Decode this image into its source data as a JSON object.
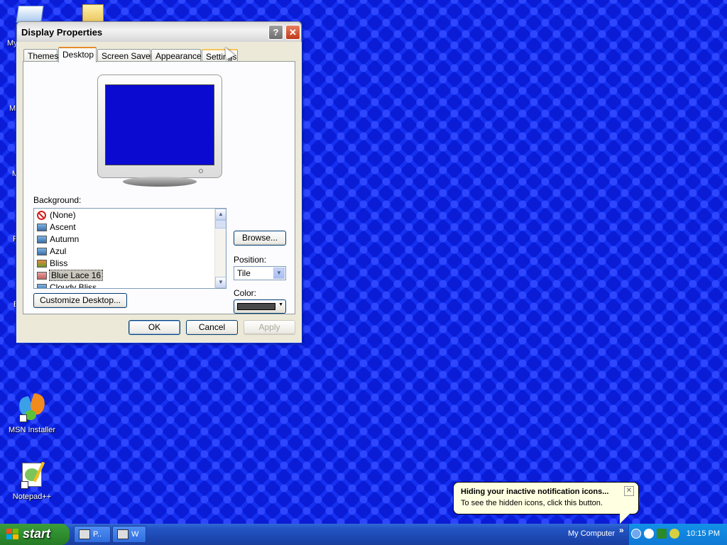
{
  "desktop": {
    "icons": [
      {
        "label": "MSN Installer",
        "icon": "msn-butterfly-icon"
      },
      {
        "label": "Notepad++",
        "icon": "notepadpp-icon"
      }
    ],
    "partial_labels": [
      "My",
      "M",
      "M",
      "R",
      "E"
    ]
  },
  "dialog": {
    "title": "Display Properties",
    "help_label": "?",
    "close_label": "✕",
    "tabs": [
      {
        "label": "Themes"
      },
      {
        "label": "Desktop"
      },
      {
        "label": "Screen Saver"
      },
      {
        "label": "Appearance"
      },
      {
        "label": "Settings"
      }
    ],
    "active_tab": "Desktop",
    "background_label": "Background:",
    "background_items": [
      {
        "label": "(None)",
        "icon": "none-icon"
      },
      {
        "label": "Ascent",
        "icon": "image-thumb-icon"
      },
      {
        "label": "Autumn",
        "icon": "image-thumb-icon"
      },
      {
        "label": "Azul",
        "icon": "image-thumb-icon"
      },
      {
        "label": "Bliss",
        "icon": "image-thumb-icon"
      },
      {
        "label": "Blue Lace 16",
        "icon": "image-thumb-icon"
      },
      {
        "label": "Cloudy Bliss",
        "icon": "image-thumb-icon"
      }
    ],
    "selected_background": "Blue Lace 16",
    "browse_label": "Browse...",
    "position_label": "Position:",
    "position_value": "Tile",
    "color_label": "Color:",
    "color_value": "#4a4a4a",
    "customize_label": "Customize Desktop...",
    "ok_label": "OK",
    "cancel_label": "Cancel",
    "apply_label": "Apply"
  },
  "balloon": {
    "title": "Hiding your inactive notification icons...",
    "text": "To see the hidden icons, click this button.",
    "close_label": "✕"
  },
  "taskbar": {
    "start_label": "start",
    "tasks": [
      {
        "label": "P..",
        "icon": "display-properties-icon"
      },
      {
        "label": "W",
        "icon": "window-icon"
      }
    ],
    "toolbar_label": "My Computer",
    "chevron": "»",
    "clock": "10:15 PM"
  },
  "colors": {
    "desktop_bg": "#0a1cd6",
    "titlebar_close": "#c0391b",
    "taskbar": "#2456c7",
    "start": "#2f8e2f",
    "tray": "#0f79d6"
  }
}
